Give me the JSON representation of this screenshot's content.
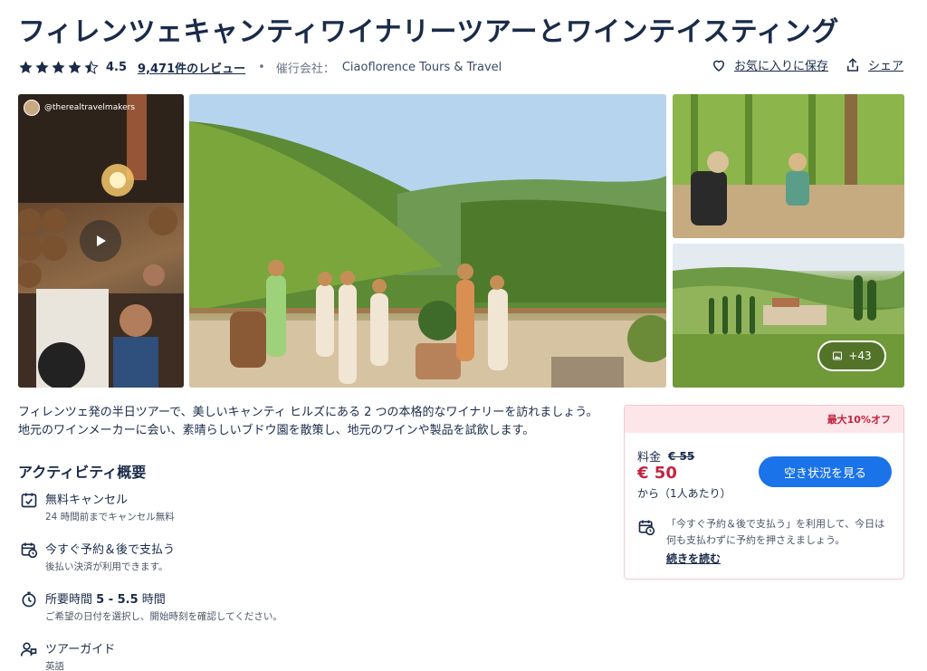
{
  "page": {
    "title": "フィレンツェキャンティワイナリーツアーとワインテイスティング",
    "rating": "4.5",
    "reviews": "9,471件のレビュー",
    "separator": "•",
    "operator_label": "催行会社：",
    "operator_name": "Ciaoflorence Tours & Travel",
    "save_label": "お気に入りに保存",
    "share_label": "シェア"
  },
  "gallery": {
    "instagram_handle": "@therealtravelmakers",
    "more_photos": "+43"
  },
  "description": {
    "line1": "フィレンツェ発の半日ツアーで、美しいキャンティ ヒルズにある 2 つの本格的なワイナリーを訪れましょう。",
    "line2": "地元のワインメーカーに会い、素晴らしいブドウ園を散策し、地元のワインや製品を試飲します。"
  },
  "overview": {
    "title": "アクティビティ概要",
    "features": [
      {
        "icon": "calendar-check-icon",
        "title": "無料キャンセル",
        "sub": "24 時間前までキャンセル無料"
      },
      {
        "icon": "calendar-clock-icon",
        "title": "今すぐ予約＆後で支払う",
        "sub": "後払い決済が利用できます。"
      },
      {
        "icon": "stopwatch-icon",
        "title_prefix": "所要時間 ",
        "title_bold": "5 - 5.5",
        "title_suffix": " 時間",
        "sub": "ご希望の日付を選択し、開始時刻を確認してください。"
      },
      {
        "icon": "guide-person-icon",
        "title": "ツアーガイド",
        "sub": "英語"
      }
    ]
  },
  "pricing": {
    "discount": "最大10%オフ",
    "from_label": "料金",
    "old_price": "€ 55",
    "new_price": "€ 50",
    "per_person": "から（1人あたり）",
    "cta": "空き状況を見る",
    "pay_later": "「今すぐ予約＆後で支払う」を利用して、今日は何も支払わずに予約を押さえましょう。",
    "read_more": "続きを読む"
  },
  "colors": {
    "brand_text": "#1a2b49",
    "cta_blue": "#1a73e8",
    "discount_red": "#c4233f",
    "discount_bg": "#fde6ea"
  }
}
